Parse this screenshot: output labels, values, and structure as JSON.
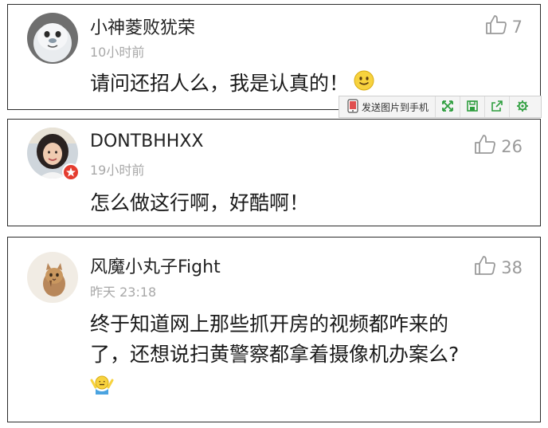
{
  "comments": [
    {
      "username": "小神菱败犹荣",
      "time": "10小时前",
      "likes": "7",
      "text": "请问还招人么，我是认真的！"
    },
    {
      "username": "DONTBHHXX",
      "time": "19小时前",
      "likes": "26",
      "text": "怎么做这行啊，好酷啊！"
    },
    {
      "username": "风魔小丸子Fight",
      "time": "昨天 23:18",
      "likes": "38",
      "text_line1": "终于知道网上那些抓开房的视频都咋来的",
      "text_line2": "了，还想说扫黄警察都拿着摄像机办案么?"
    }
  ],
  "toolbar": {
    "send_label": "发送图片到手机"
  },
  "icons": {
    "like": "thumbs-up-icon",
    "smiley": "smiley-emoji-icon",
    "shrug": "shrug-emoji-icon",
    "phone": "phone-send-icon",
    "expand": "expand-icon",
    "save": "save-icon",
    "share": "share-icon",
    "settings": "gear-icon"
  },
  "colors": {
    "border": "#2b2b2b",
    "muted_text": "#a8a8a8",
    "like_text": "#9a9a9a",
    "toolbar_green": "#2e9e3e"
  }
}
